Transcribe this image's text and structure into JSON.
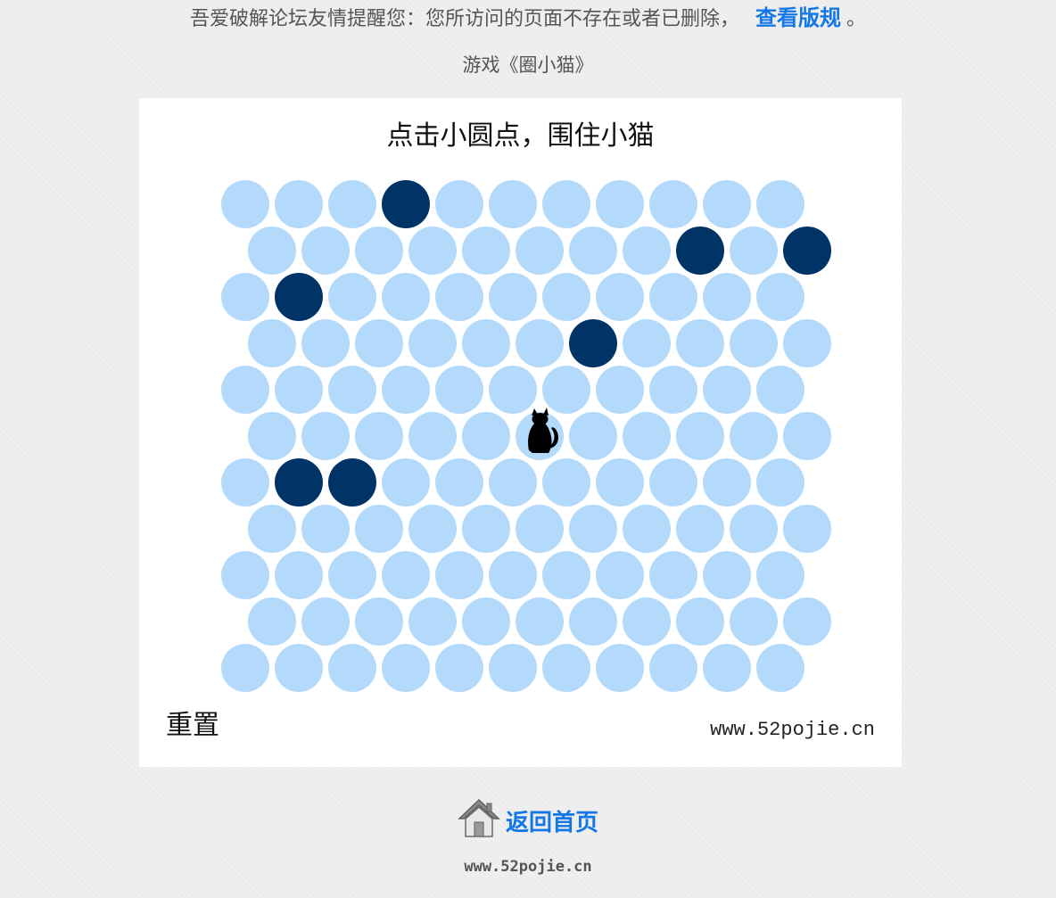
{
  "notice": {
    "message": "吾爱破解论坛友情提醒您：您所访问的页面不存在或者已删除，",
    "link_label": "查看版规",
    "suffix": "。"
  },
  "game": {
    "title": "游戏《圈小猫》",
    "instruction": "点击小圆点，围住小猫",
    "reset_label": "重置",
    "watermark": "www.52pojie.cn",
    "grid": {
      "rows": 11,
      "cols": 11,
      "blocked": [
        [
          0,
          3
        ],
        [
          1,
          8
        ],
        [
          1,
          10
        ],
        [
          2,
          1
        ],
        [
          3,
          6
        ],
        [
          6,
          1
        ],
        [
          6,
          2
        ]
      ],
      "cat": [
        5,
        5
      ]
    },
    "colors": {
      "open_dot": "#b3d9fb",
      "blocked_dot": "#003366",
      "cat": "#000000"
    },
    "icons": {
      "cat": "cat-icon",
      "home": "house-icon"
    }
  },
  "footer": {
    "home_label": "返回首页",
    "site": "www.52pojie.cn"
  }
}
